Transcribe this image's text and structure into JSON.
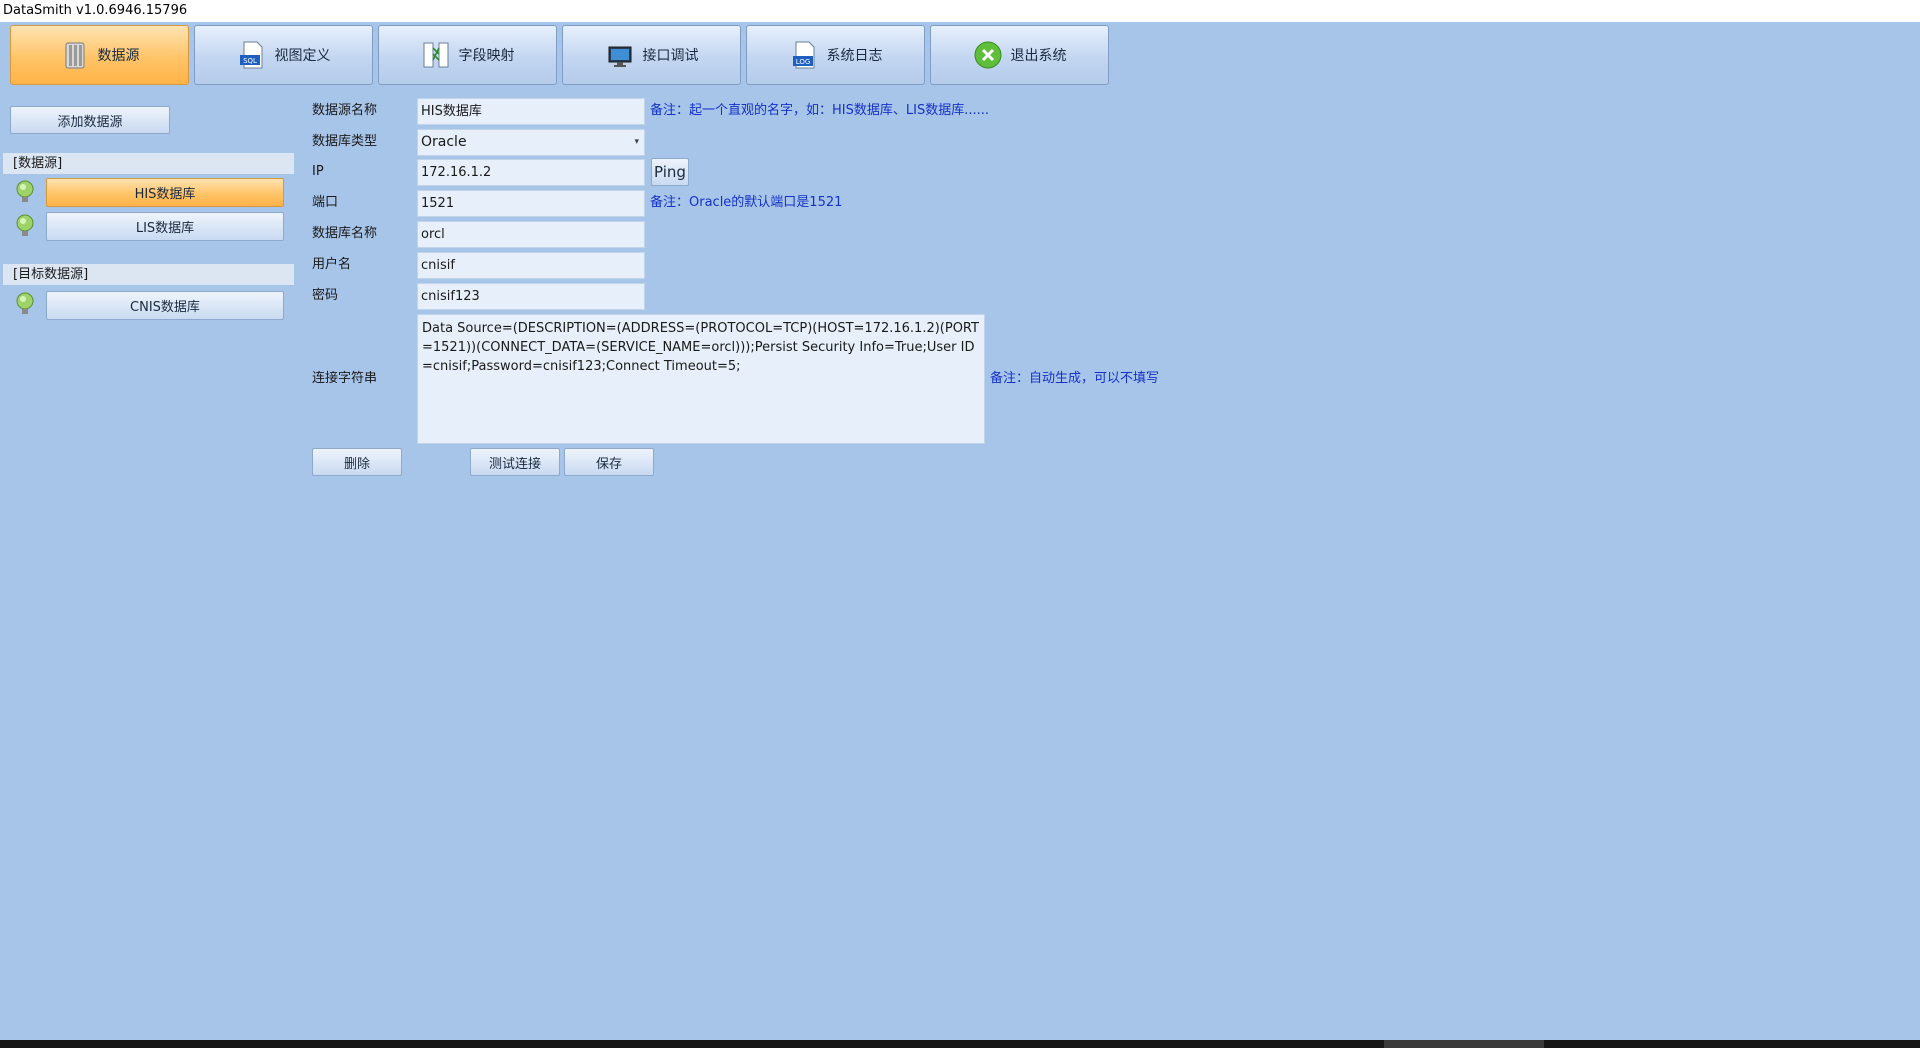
{
  "window": {
    "title": "DataSmith  v1.0.6946.15796"
  },
  "toolbar": {
    "tabs": [
      {
        "label": "数据源",
        "icon": "database-icon"
      },
      {
        "label": "视图定义",
        "icon": "sql-file-icon"
      },
      {
        "label": "字段映射",
        "icon": "field-mapping-icon"
      },
      {
        "label": "接口调试",
        "icon": "monitor-debug-icon"
      },
      {
        "label": "系统日志",
        "icon": "log-file-icon"
      },
      {
        "label": "退出系统",
        "icon": "exit-icon"
      }
    ]
  },
  "sidebar": {
    "add_button": "添加数据源",
    "source_group": "[数据源]",
    "sources": [
      "HIS数据库",
      "LIS数据库"
    ],
    "target_group": "[目标数据源]",
    "targets": [
      "CNIS数据库"
    ]
  },
  "form": {
    "name_label": "数据源名称",
    "name_value": "HIS数据库",
    "name_note": "备注：起一个直观的名字，如：HIS数据库、LIS数据库......",
    "type_label": "数据库类型",
    "type_value": "Oracle",
    "ip_label": "IP",
    "ip_value": "172.16.1.2",
    "ping_label": "Ping",
    "port_label": "端口",
    "port_value": "1521",
    "port_note": "备注：Oracle的默认端口是1521",
    "dbname_label": "数据库名称",
    "dbname_value": "orcl",
    "user_label": "用户名",
    "user_value": "cnisif",
    "password_label": "密码",
    "password_value": "cnisif123",
    "connstr_label": "连接字符串",
    "connstr_value": "Data Source=(DESCRIPTION=(ADDRESS=(PROTOCOL=TCP)(HOST=172.16.1.2)(PORT=1521))(CONNECT_DATA=(SERVICE_NAME=orcl)));Persist Security Info=True;User ID=cnisif;Password=cnisif123;Connect Timeout=5;",
    "connstr_note": "备注：自动生成，可以不填写"
  },
  "actions": {
    "delete": "删除",
    "test": "测试连接",
    "save": "保存"
  },
  "colors": {
    "background": "#a7c4e9",
    "active_accent": "#ffc468",
    "note_text": "#1532c8"
  }
}
